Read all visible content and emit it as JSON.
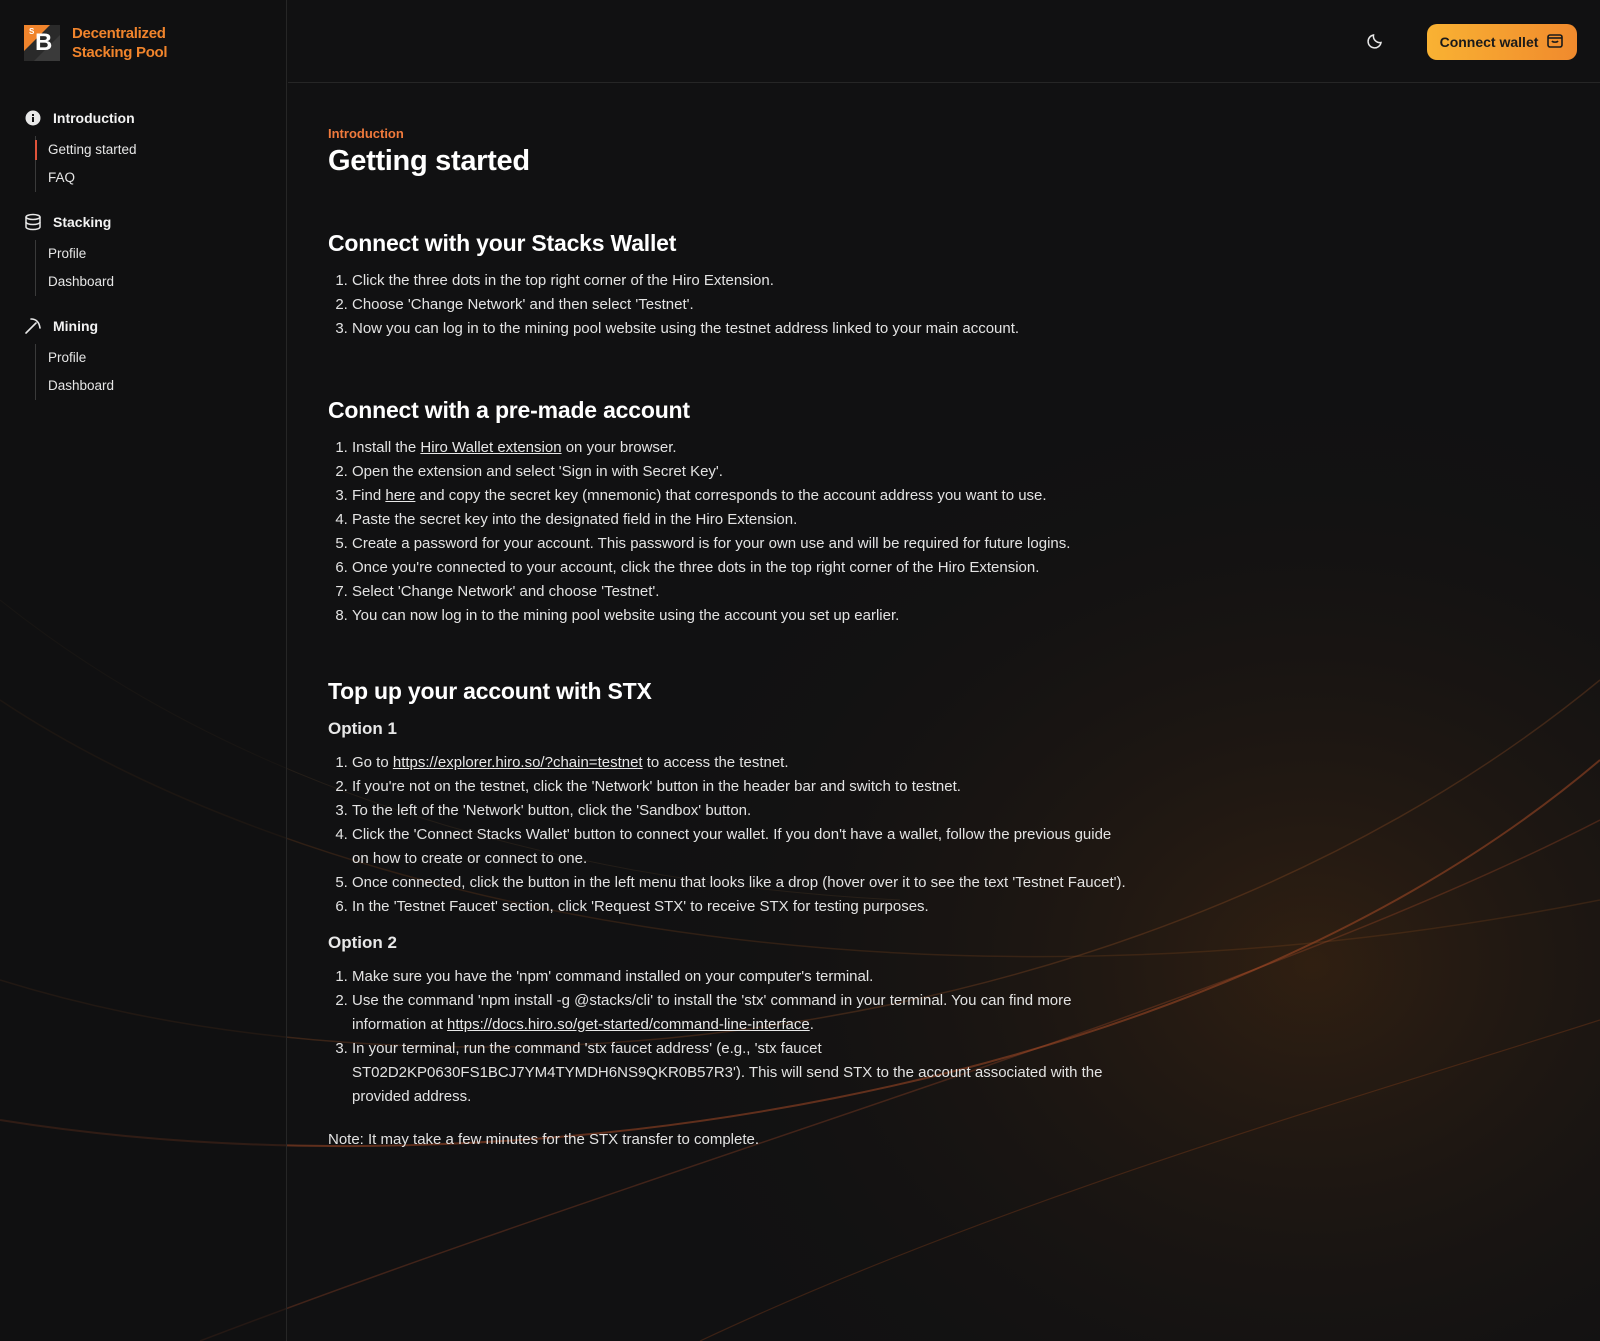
{
  "app": {
    "logo_line1": "Decentralized",
    "logo_line2": "Stacking Pool",
    "logo_letter": "B",
    "logo_small": "S",
    "accent": "#f0842c"
  },
  "sidebar": {
    "groups": [
      {
        "label": "Introduction",
        "icon": "info-icon",
        "items": [
          {
            "label": "Getting started",
            "active": true
          },
          {
            "label": "FAQ"
          }
        ]
      },
      {
        "label": "Stacking",
        "icon": "database-icon",
        "items": [
          {
            "label": "Profile"
          },
          {
            "label": "Dashboard"
          }
        ]
      },
      {
        "label": "Mining",
        "icon": "pickaxe-icon",
        "items": [
          {
            "label": "Profile"
          },
          {
            "label": "Dashboard"
          }
        ]
      }
    ]
  },
  "header": {
    "theme_icon": "moon-icon",
    "connect_label": "Connect wallet",
    "connect_icon": "wallet-icon"
  },
  "main": {
    "eyebrow": "Introduction",
    "title": "Getting started",
    "s1": {
      "title": "Connect with your Stacks Wallet",
      "steps": [
        "Click the three dots in the top right corner of the Hiro Extension.",
        "Choose 'Change Network' and then select 'Testnet'.",
        "Now you can log in to the mining pool website using the testnet address linked to your main account."
      ]
    },
    "s2": {
      "title": "Connect with a pre-made account",
      "step1_pre": "Install the ",
      "step1_link": "Hiro Wallet extension",
      "step1_post": " on your browser.",
      "step2": "Open the extension and select 'Sign in with Secret Key'.",
      "step3_pre": "Find ",
      "step3_link": "here",
      "step3_post": " and copy the secret key (mnemonic) that corresponds to the account address you want to use.",
      "step4": "Paste the secret key into the designated field in the Hiro Extension.",
      "step5": "Create a password for your account. This password is for your own use and will be required for future logins.",
      "step6": "Once you're connected to your account, click the three dots in the top right corner of the Hiro Extension.",
      "step7": "Select 'Change Network' and choose 'Testnet'.",
      "step8": "You can now log in to the mining pool website using the account you set up earlier."
    },
    "s3": {
      "title": "Top up your account with STX",
      "opt1_title": "Option 1",
      "o1_step1_pre": "Go to ",
      "o1_step1_link": "https://explorer.hiro.so/?chain=testnet",
      "o1_step1_post": " to access the testnet.",
      "o1_step2": "If you're not on the testnet, click the 'Network' button in the header bar and switch to testnet.",
      "o1_step3": "To the left of the 'Network' button, click the 'Sandbox' button.",
      "o1_step4": "Click the 'Connect Stacks Wallet' button to connect your wallet. If you don't have a wallet, follow the previous guide on how to create or connect to one.",
      "o1_step5": "Once connected, click the button in the left menu that looks like a drop (hover over it to see the text 'Testnet Faucet').",
      "o1_step6": "In the 'Testnet Faucet' section, click 'Request STX' to receive STX for testing purposes.",
      "opt2_title": "Option 2",
      "o2_step1": "Make sure you have the 'npm' command installed on your computer's terminal.",
      "o2_step2_pre": "Use the command 'npm install -g @stacks/cli' to install the 'stx' command in your terminal. You can find more information at ",
      "o2_step2_link": "https://docs.hiro.so/get-started/command-line-interface",
      "o2_step2_post": ".",
      "o2_step3": "In your terminal, run the command 'stx faucet address' (e.g., 'stx faucet ST02D2KP0630FS1BCJ7YM4TYMDH6NS9QKR0B57R3'). This will send STX to the account associated with the provided address."
    },
    "note": "Note: It may take a few minutes for the STX transfer to complete."
  }
}
